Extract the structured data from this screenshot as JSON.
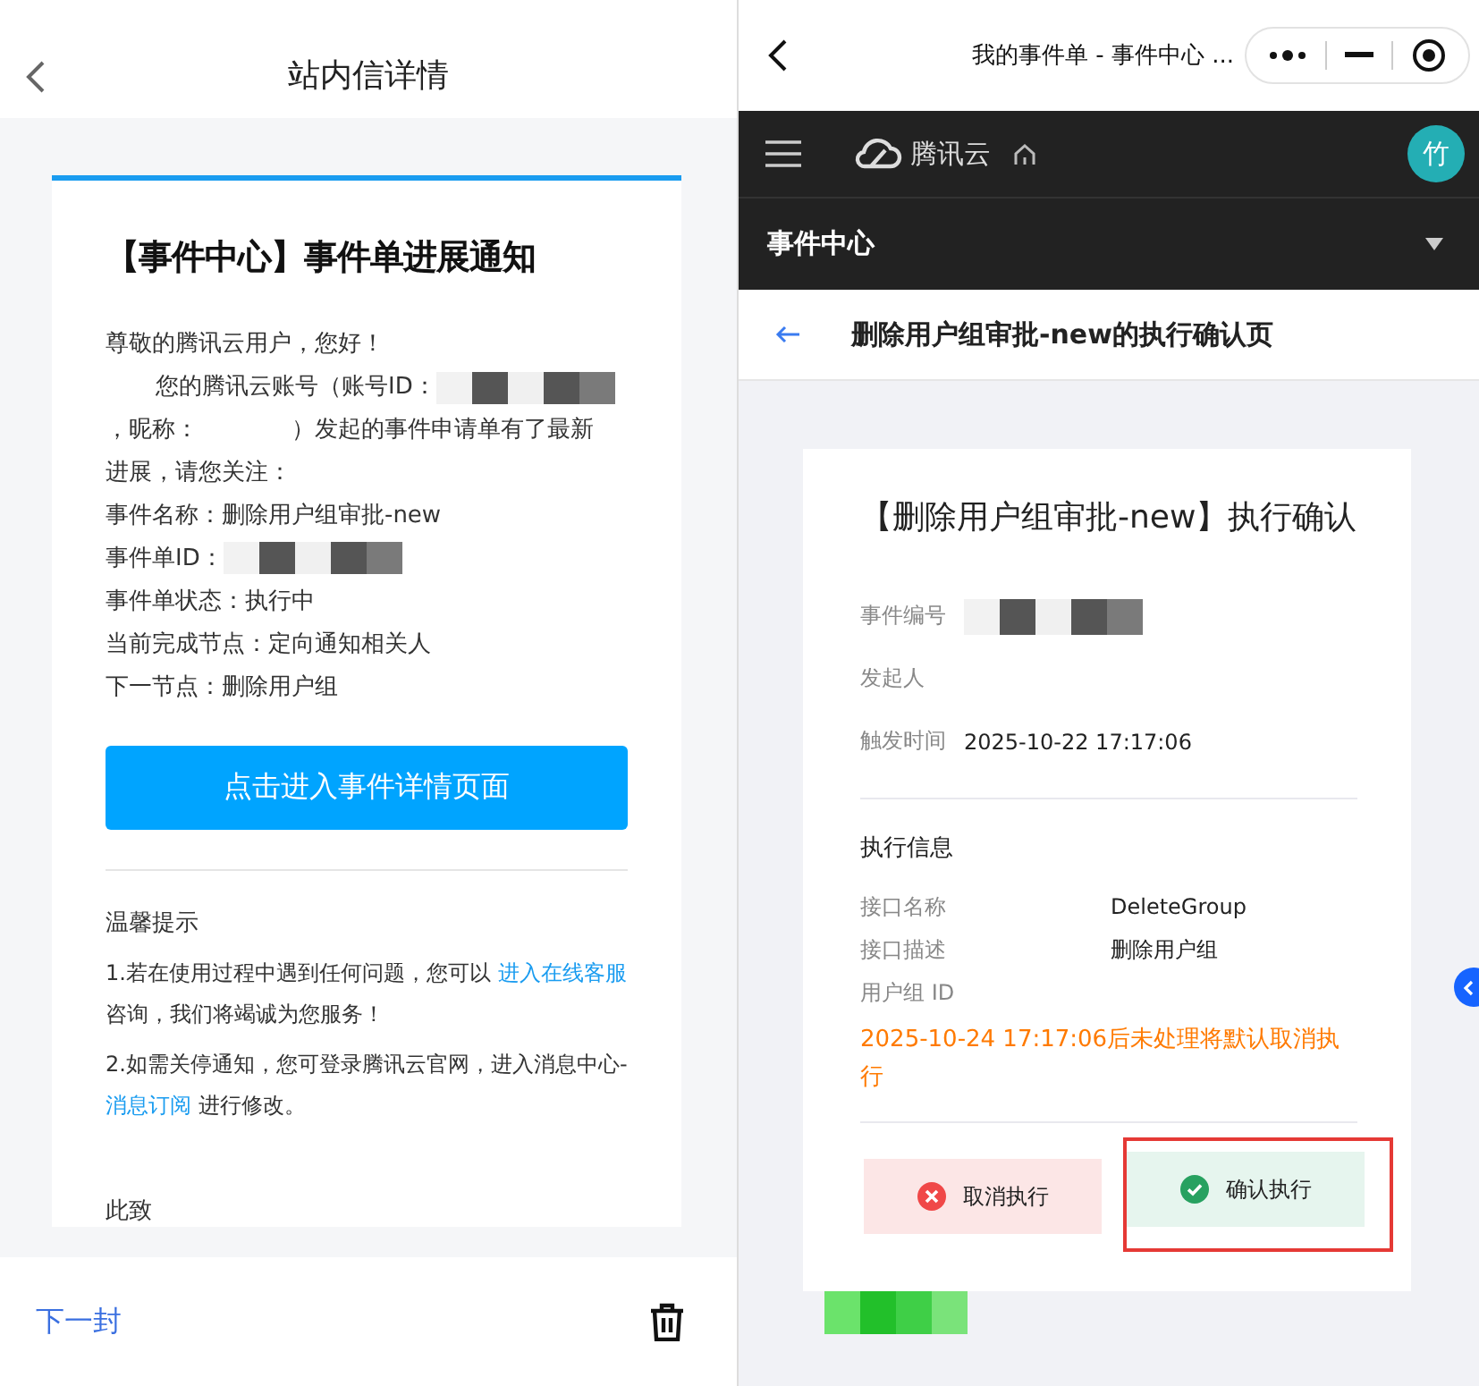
{
  "mail": {
    "header": {
      "title": "站内信详情"
    },
    "card": {
      "title": "【事件中心】事件单进展通知",
      "greeting": "尊敬的腾讯云用户，您好！",
      "intro": [
        [
          {
            "kind": "indent"
          },
          {
            "kind": "text",
            "text": "您的腾讯云账号（账号ID："
          },
          {
            "kind": "redacted"
          }
        ],
        [
          {
            "kind": "text",
            "text": "，昵称："
          },
          {
            "kind": "gap"
          },
          {
            "kind": "text",
            "text": "）发起的事件申请单有了最新"
          }
        ],
        [
          {
            "kind": "text",
            "text": "进展，请您关注："
          }
        ]
      ],
      "fields": [
        {
          "kind": "text",
          "label": "事件名称：",
          "value": "删除用户组审批-new"
        },
        {
          "kind": "redacted",
          "label": "事件单ID："
        },
        {
          "kind": "text",
          "label": "事件单状态：",
          "value": "执行中"
        },
        {
          "kind": "text",
          "label": "当前完成节点：",
          "value": "定向通知相关人"
        },
        {
          "kind": "text",
          "label": "下一节点：",
          "value": "删除用户组"
        }
      ],
      "button": "点击进入事件详情页面",
      "tips_title": "温馨提示",
      "tips": [
        [
          {
            "kind": "text",
            "text": "1.若在使用过程中遇到任何问题，您可以 "
          },
          {
            "kind": "link",
            "text": "进入在线客服"
          },
          {
            "kind": "text",
            "text": " 咨询，我们将竭诚为您服务！"
          }
        ],
        [
          {
            "kind": "text",
            "text": "2.如需关停通知，您可登录腾讯云官网，进入消息中心-"
          },
          {
            "kind": "link",
            "text": "消息订阅"
          },
          {
            "kind": "text",
            "text": " 进行修改。"
          }
        ]
      ],
      "closing": "此致"
    },
    "footer": {
      "next": "下一封"
    }
  },
  "console": {
    "topbar": {
      "title": "我的事件单 - 事件中心 ..."
    },
    "brand": "腾讯云",
    "avatar": "竹",
    "section": "事件中心",
    "page_title": "删除用户组审批-new的执行确认页",
    "card": {
      "title": "【删除用户组审批-new】执行确认",
      "meta": [
        {
          "kind": "redacted",
          "label": "事件编号"
        },
        {
          "kind": "blank",
          "label": "发起人"
        },
        {
          "kind": "text",
          "label": "触发时间",
          "value": "2025-10-22 17:17:06"
        }
      ],
      "section": "执行信息",
      "rows": [
        {
          "kind": "text",
          "label": "接口名称",
          "value": "DeleteGroup"
        },
        {
          "kind": "text",
          "label": "接口描述",
          "value": "删除用户组"
        },
        {
          "kind": "blank",
          "label": "用户组 ID"
        }
      ],
      "warning": "2025-10-24 17:17:06后未处理将默认取消执行",
      "buttons": [
        {
          "kind": "cancel",
          "label": "取消执行",
          "highlighted": false
        },
        {
          "kind": "confirm",
          "label": "确认执行",
          "highlighted": true
        }
      ]
    }
  }
}
